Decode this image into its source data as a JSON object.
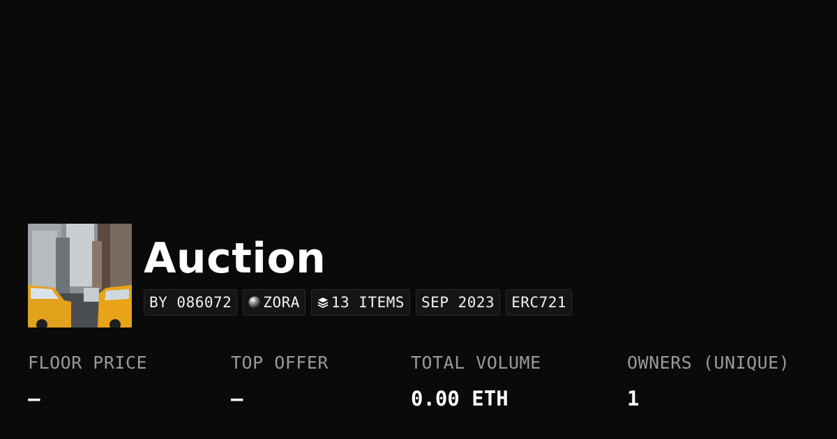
{
  "collection": {
    "title": "Auction",
    "thumbnail_alt": "Taxis on a city street"
  },
  "chips": [
    {
      "label": "BY 086072",
      "icon": ""
    },
    {
      "label": "ZORA",
      "icon": "zora-orb-icon"
    },
    {
      "label": "13 ITEMS",
      "icon": "layers-icon"
    },
    {
      "label": "SEP 2023",
      "icon": ""
    },
    {
      "label": "ERC721",
      "icon": ""
    }
  ],
  "stats": [
    {
      "label": "FLOOR PRICE",
      "value": "–"
    },
    {
      "label": "TOP OFFER",
      "value": "–"
    },
    {
      "label": "TOTAL VOLUME",
      "value": "0.00 ETH"
    },
    {
      "label": "OWNERS (UNIQUE)",
      "value": "1"
    }
  ],
  "colors": {
    "background": "#0a0a0a",
    "label": "#9a9a9a",
    "chip_bg": "#151515",
    "taxi_yellow": "#e8a317"
  }
}
